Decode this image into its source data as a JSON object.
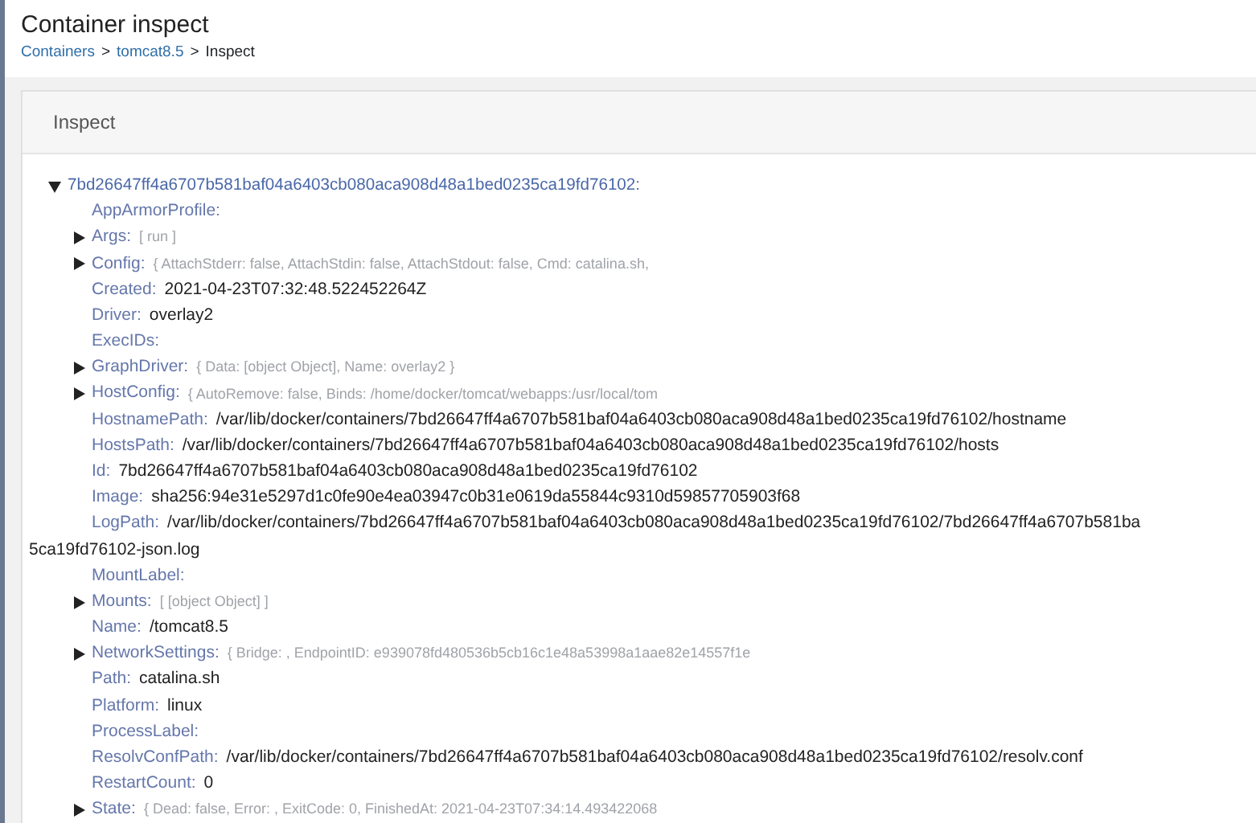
{
  "page": {
    "title": "Container inspect",
    "breadcrumb": [
      {
        "label": "Containers",
        "link": true
      },
      {
        "label": "tomcat8.5",
        "link": true
      },
      {
        "label": "Inspect",
        "link": false
      }
    ],
    "separator": ">"
  },
  "panel": {
    "title": "Inspect"
  },
  "tree": {
    "key": "7bd26647ff4a6707b581baf04a6403cb080aca908d48a1bed0235ca19fd76102:",
    "expanded": true,
    "children": [
      {
        "key": "AppArmorProfile:",
        "kind": "value"
      },
      {
        "key": "Args:",
        "kind": "object",
        "expanded": false,
        "value": "[ run ]"
      },
      {
        "key": "Config:",
        "kind": "object",
        "expanded": false,
        "value": "{ AttachStderr: false, AttachStdin: false, AttachStdout: false, Cmd: catalina.sh,"
      },
      {
        "key": "Created:",
        "kind": "value",
        "value": "2021-04-23T07:32:48.522452264Z"
      },
      {
        "key": "Driver:",
        "kind": "value",
        "value": "overlay2"
      },
      {
        "key": "ExecIDs:",
        "kind": "value"
      },
      {
        "key": "GraphDriver:",
        "kind": "object",
        "expanded": false,
        "value": "{ Data: [object Object], Name: overlay2 }"
      },
      {
        "key": "HostConfig:",
        "kind": "object",
        "expanded": false,
        "value": "{ AutoRemove: false, Binds: /home/docker/tomcat/webapps:/usr/local/tom"
      },
      {
        "key": "HostnamePath:",
        "kind": "value",
        "value": "/var/lib/docker/containers/7bd26647ff4a6707b581baf04a6403cb080aca908d48a1bed0235ca19fd76102/hostname"
      },
      {
        "key": "HostsPath:",
        "kind": "value",
        "value": "/var/lib/docker/containers/7bd26647ff4a6707b581baf04a6403cb080aca908d48a1bed0235ca19fd76102/hosts"
      },
      {
        "key": "Id:",
        "kind": "value",
        "value": "7bd26647ff4a6707b581baf04a6403cb080aca908d48a1bed0235ca19fd76102"
      },
      {
        "key": "Image:",
        "kind": "value",
        "value": "sha256:94e31e5297d1c0fe90e4ea03947c0b31e0619da55844c9310d59857705903f68"
      },
      {
        "key": "LogPath:",
        "kind": "value",
        "value": "/var/lib/docker/containers/7bd26647ff4a6707b581baf04a6403cb080aca908d48a1bed0235ca19fd76102/7bd26647ff4a6707b581ba",
        "value_wrap": "5ca19fd76102-json.log"
      },
      {
        "key": "MountLabel:",
        "kind": "value"
      },
      {
        "key": "Mounts:",
        "kind": "object",
        "expanded": false,
        "value": "[ [object Object] ]"
      },
      {
        "key": "Name:",
        "kind": "value",
        "value": "/tomcat8.5"
      },
      {
        "key": "NetworkSettings:",
        "kind": "object",
        "expanded": false,
        "value": "{ Bridge: , EndpointID: e939078fd480536b5cb16c1e48a53998a1aae82e14557f1e"
      },
      {
        "key": "Path:",
        "kind": "value",
        "value": "catalina.sh"
      },
      {
        "key": "Platform:",
        "kind": "value",
        "value": "linux"
      },
      {
        "key": "ProcessLabel:",
        "kind": "value"
      },
      {
        "key": "ResolvConfPath:",
        "kind": "value",
        "value": "/var/lib/docker/containers/7bd26647ff4a6707b581baf04a6403cb080aca908d48a1bed0235ca19fd76102/resolv.conf"
      },
      {
        "key": "RestartCount:",
        "kind": "value",
        "value": "0"
      },
      {
        "key": "State:",
        "kind": "object",
        "expanded": false,
        "value": "{ Dead: false, Error: , ExitCode: 0, FinishedAt: 2021-04-23T07:34:14.493422068"
      }
    ]
  }
}
